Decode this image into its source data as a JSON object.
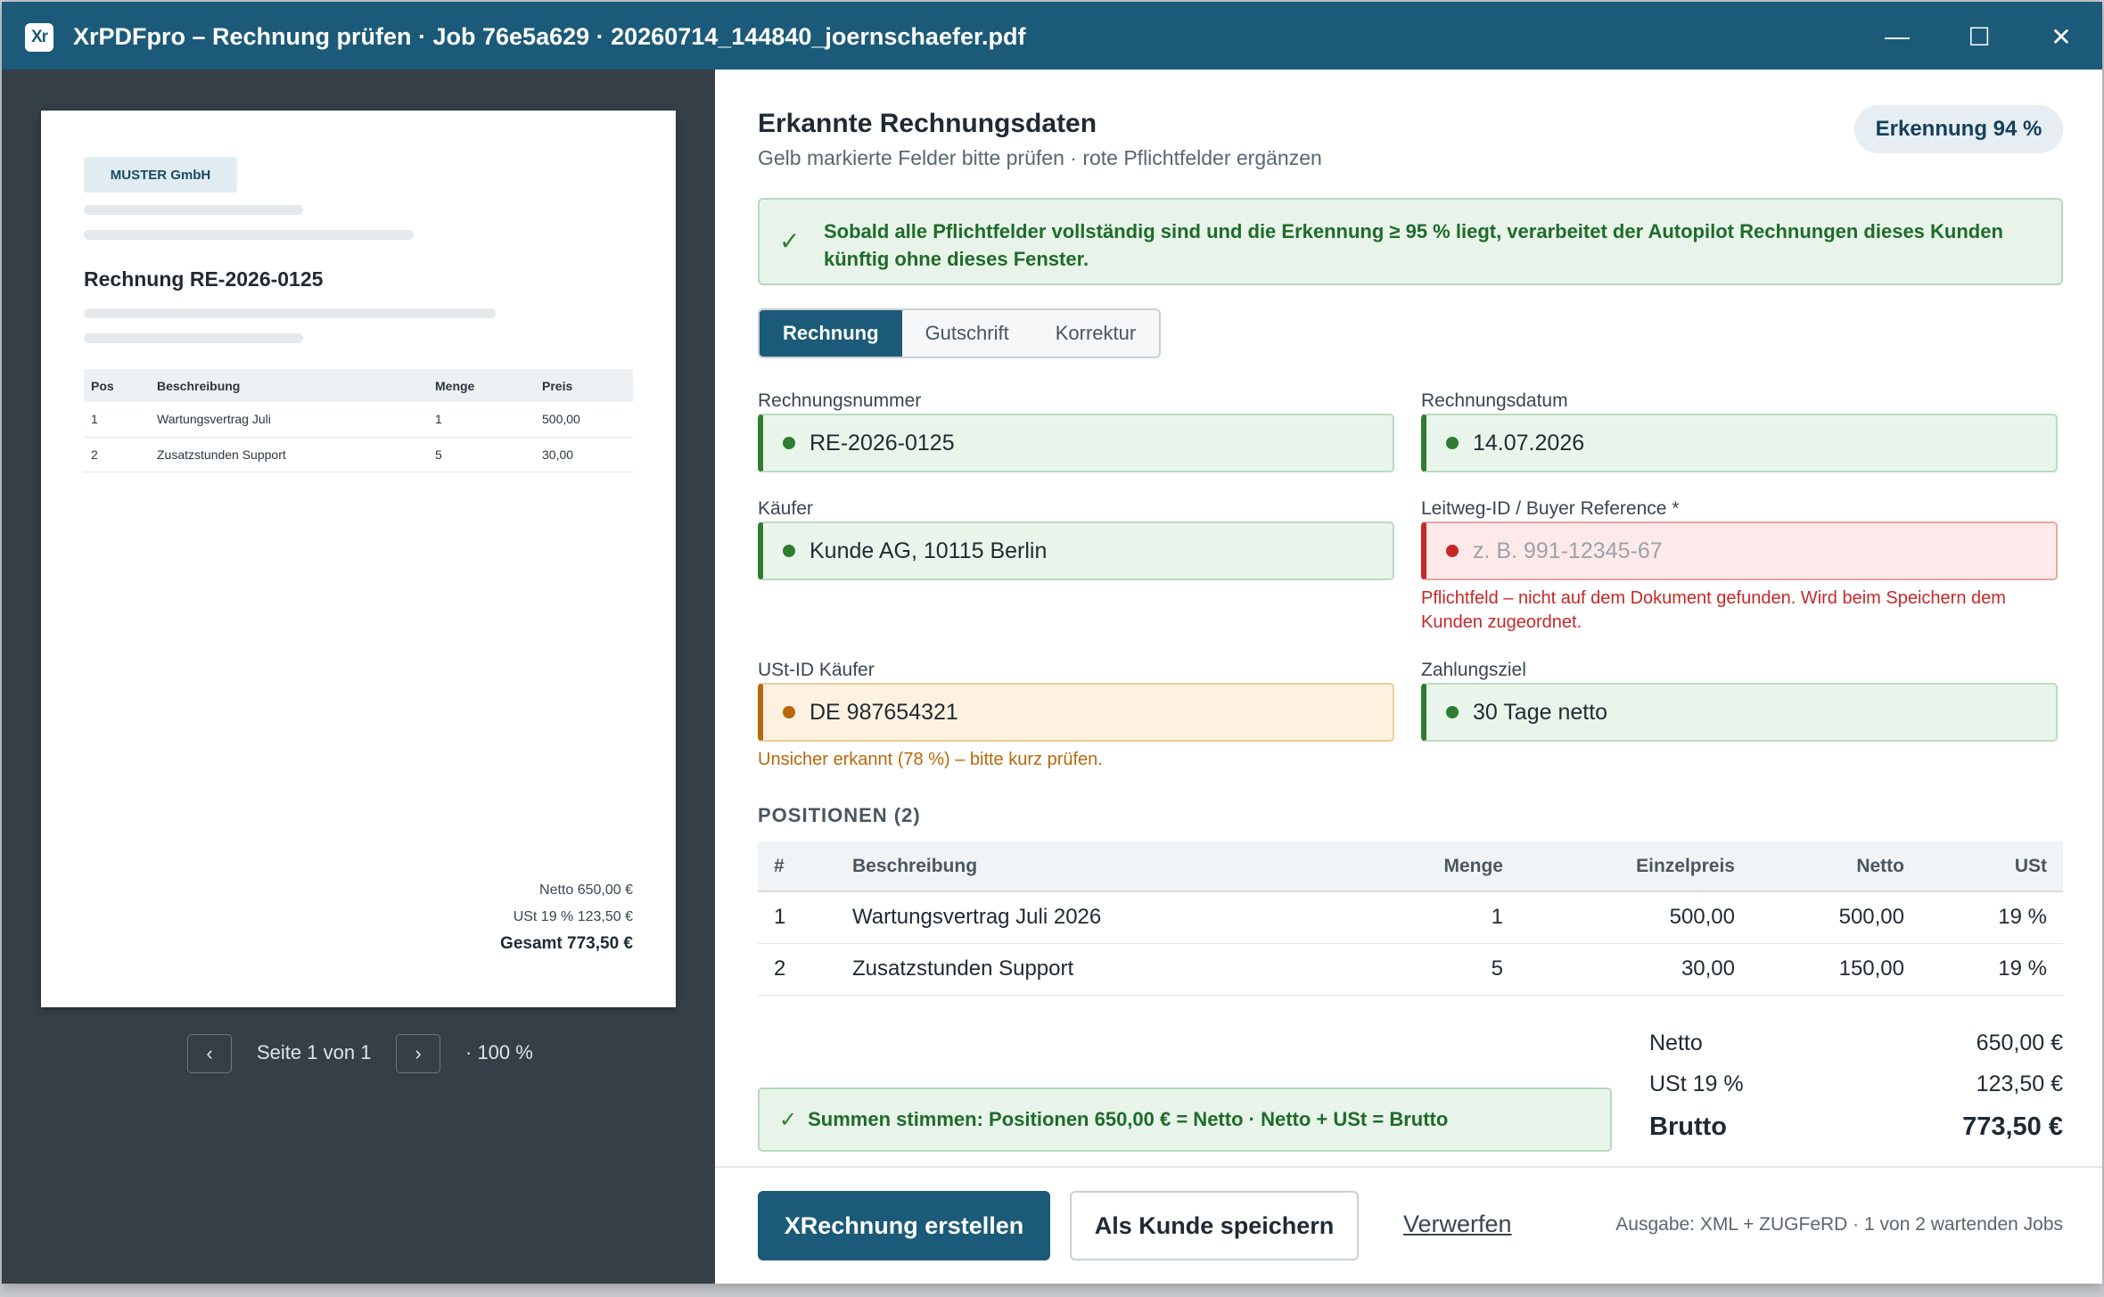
{
  "window": {
    "logo": "Xr",
    "title": "XrPDFpro – Rechnung prüfen · Job 76e5a629 · 20260714_144840_joernschaefer.pdf",
    "minimize": "—",
    "maximize": "☐",
    "close": "✕"
  },
  "preview": {
    "company_logo": "MUSTER GmbH",
    "doc_title": "Rechnung RE-2026-0125",
    "table_headers": [
      "Pos",
      "Beschreibung",
      "Menge",
      "Preis"
    ],
    "rows": [
      {
        "pos": "1",
        "desc": "Wartungsvertrag Juli",
        "qty": "1",
        "price": "500,00"
      },
      {
        "pos": "2",
        "desc": "Zusatzstunden Support",
        "qty": "5",
        "price": "30,00"
      }
    ],
    "netto": "Netto 650,00 €",
    "ust": "USt 19 % 123,50 €",
    "gesamt": "Gesamt 773,50 €",
    "pager": {
      "prev": "‹",
      "next": "›",
      "page_text": "Seite 1 von 1",
      "zoom": "· 100 %"
    }
  },
  "panel": {
    "heading": "Erkannte Rechnungsdaten",
    "subheading": "Gelb markierte Felder bitte prüfen · rote Pflichtfelder ergänzen",
    "recognition_badge": "Erkennung 94 %",
    "info_icon": "✓",
    "info_text": "Sobald alle Pflichtfelder vollständig sind und die Erkennung ≥ 95 % liegt, verarbeitet der Autopilot Rechnungen dieses Kunden künftig ohne dieses Fenster.",
    "doc_types": [
      "Rechnung",
      "Gutschrift",
      "Korrektur"
    ],
    "active_doc_type": "Rechnung",
    "fields": {
      "rechnungsnummer": {
        "label": "Rechnungsnummer",
        "value": "RE-2026-0125"
      },
      "rechnungsdatum": {
        "label": "Rechnungsdatum",
        "value": "14.07.2026"
      },
      "kaeufer": {
        "label": "Käufer",
        "value": "Kunde AG, 10115 Berlin"
      },
      "leitweg": {
        "label": "Leitweg-ID / Buyer Reference *",
        "value": "",
        "placeholder": "z. B. 991-12345-67",
        "error": "Pflichtfeld – nicht auf dem Dokument gefunden. Wird beim Speichern dem Kunden zugeordnet."
      },
      "ust_id": {
        "label": "USt-ID Käufer",
        "value": "DE 987654321",
        "warning": "Unsicher erkannt (78 %) – bitte kurz prüfen."
      },
      "zahlungsziel": {
        "label": "Zahlungsziel",
        "value": "30 Tage netto"
      }
    },
    "positions_heading": "POSITIONEN (2)",
    "positions_headers": [
      "#",
      "Beschreibung",
      "Menge",
      "Einzelpreis",
      "Netto",
      "USt"
    ],
    "positions": [
      {
        "nr": "1",
        "desc": "Wartungsvertrag Juli 2026",
        "qty": "1",
        "unit": "500,00",
        "net": "500,00",
        "vat": "19 %"
      },
      {
        "nr": "2",
        "desc": "Zusatzstunden Support",
        "qty": "5",
        "unit": "30,00",
        "net": "150,00",
        "vat": "19 %"
      }
    ],
    "sum_check_icon": "✓",
    "sum_check": "Summen stimmen: Positionen 650,00 € = Netto · Netto + USt = Brutto",
    "totals": {
      "netto_label": "Netto",
      "netto": "650,00 €",
      "ust_label": "USt 19 %",
      "ust": "123,50 €",
      "brutto_label": "Brutto",
      "brutto": "773,50 €"
    }
  },
  "footer": {
    "create": "XRechnung erstellen",
    "save_customer": "Als Kunde speichern",
    "discard": "Verwerfen",
    "info": "Ausgabe: XML + ZUGFeRD · 1 von 2 wartenden Jobs"
  },
  "colors": {
    "brand": "#1b5a78",
    "ok": "#2e7d32",
    "error": "#c62828",
    "warning": "#b8680b"
  }
}
